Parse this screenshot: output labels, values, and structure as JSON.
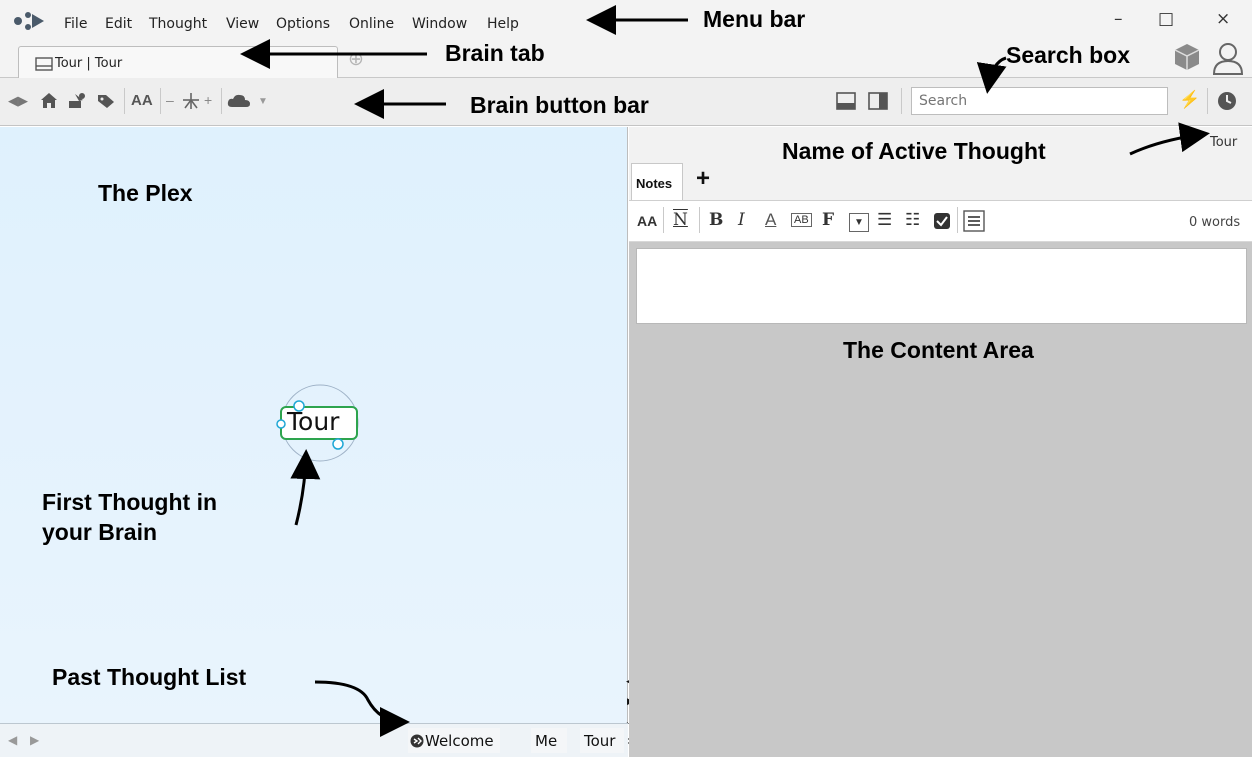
{
  "menu": {
    "items": [
      "File",
      "Edit",
      "Thought",
      "View",
      "Options",
      "Online",
      "Window",
      "Help"
    ],
    "minimize": "–",
    "maximize": "□",
    "close": "×"
  },
  "tab": {
    "label": "Tour | Tour",
    "add_symbol": "⊕"
  },
  "toolbar": {
    "icons": [
      "back-forward-icon",
      "home-icon",
      "pin-icon",
      "tag-icon",
      "font-size-icon",
      "layout-icon",
      "cloud-icon"
    ],
    "font_label": "AA",
    "search_placeholder": "Search"
  },
  "plex": {
    "active_thought": "Tour"
  },
  "content": {
    "active_thought_name": "Tour",
    "notes_tab": "Notes",
    "add_tab": "+",
    "word_count": "0 words"
  },
  "past_thoughts": {
    "items": [
      "Welcome ...",
      "Me",
      "Tour"
    ]
  },
  "annotations": {
    "menu_bar": "Menu bar",
    "brain_tab": "Brain tab",
    "search_box": "Search box",
    "brain_button_bar": "Brain button bar",
    "active_thought_name": "Name of Active Thought",
    "the_plex": "The Plex",
    "content_area": "The Content Area",
    "first_thought_line1": "First Thought in",
    "first_thought_line2": "your Brain",
    "past_thought_list": "Past Thought List"
  },
  "colors": {
    "plex_bg": "#dff1fd",
    "thought_border": "#2da44e",
    "thought_handle": "#1fa7d6",
    "content_bg": "#c8c8c8"
  }
}
